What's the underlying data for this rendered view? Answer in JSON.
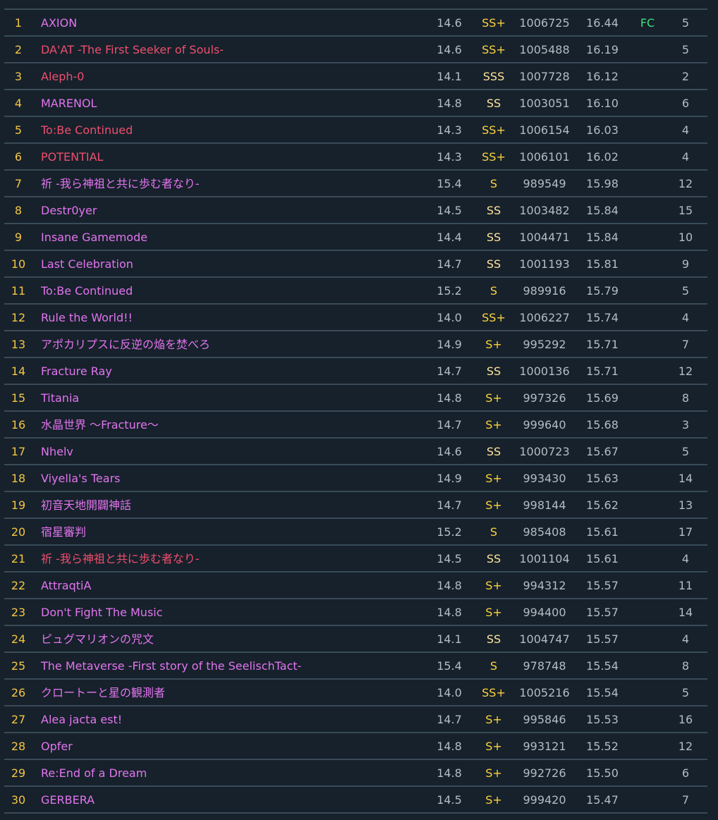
{
  "colors": {
    "background": "#16212b",
    "rank": "#f5c542",
    "title_default": "#e374ef",
    "title_highlight": "#f04e6e",
    "grade": "#ffd23f",
    "value": "#b4bcc4",
    "lamp": "#3fe07a"
  },
  "rows": [
    {
      "rank": "1",
      "title": "AXION",
      "style": "magenta",
      "const": "14.6",
      "grade": "SS+",
      "score": "1006725",
      "rating": "16.44",
      "lamp": "FC",
      "count": "5"
    },
    {
      "rank": "2",
      "title": "DA'AT -The First Seeker of Souls-",
      "style": "red",
      "const": "14.6",
      "grade": "SS+",
      "score": "1005488",
      "rating": "16.19",
      "lamp": "",
      "count": "5"
    },
    {
      "rank": "3",
      "title": "Aleph-0",
      "style": "red",
      "const": "14.1",
      "grade": "SSS",
      "score": "1007728",
      "rating": "16.12",
      "lamp": "",
      "count": "2"
    },
    {
      "rank": "4",
      "title": "MARENOL",
      "style": "magenta",
      "const": "14.8",
      "grade": "SS",
      "score": "1003051",
      "rating": "16.10",
      "lamp": "",
      "count": "6"
    },
    {
      "rank": "5",
      "title": "To:Be Continued",
      "style": "red",
      "const": "14.3",
      "grade": "SS+",
      "score": "1006154",
      "rating": "16.03",
      "lamp": "",
      "count": "4"
    },
    {
      "rank": "6",
      "title": "POTENTIAL",
      "style": "red",
      "const": "14.3",
      "grade": "SS+",
      "score": "1006101",
      "rating": "16.02",
      "lamp": "",
      "count": "4"
    },
    {
      "rank": "7",
      "title": "祈 -我ら神祖と共に歩む者なり-",
      "style": "magenta",
      "const": "15.4",
      "grade": "S",
      "score": "989549",
      "rating": "15.98",
      "lamp": "",
      "count": "12"
    },
    {
      "rank": "8",
      "title": "Destr0yer",
      "style": "magenta",
      "const": "14.5",
      "grade": "SS",
      "score": "1003482",
      "rating": "15.84",
      "lamp": "",
      "count": "15"
    },
    {
      "rank": "9",
      "title": "Insane Gamemode",
      "style": "magenta",
      "const": "14.4",
      "grade": "SS",
      "score": "1004471",
      "rating": "15.84",
      "lamp": "",
      "count": "10"
    },
    {
      "rank": "10",
      "title": "Last Celebration",
      "style": "magenta",
      "const": "14.7",
      "grade": "SS",
      "score": "1001193",
      "rating": "15.81",
      "lamp": "",
      "count": "9"
    },
    {
      "rank": "11",
      "title": "To:Be Continued",
      "style": "magenta",
      "const": "15.2",
      "grade": "S",
      "score": "989916",
      "rating": "15.79",
      "lamp": "",
      "count": "5"
    },
    {
      "rank": "12",
      "title": "Rule the World!!",
      "style": "magenta",
      "const": "14.0",
      "grade": "SS+",
      "score": "1006227",
      "rating": "15.74",
      "lamp": "",
      "count": "4"
    },
    {
      "rank": "13",
      "title": "アポカリプスに反逆の焔を焚べろ",
      "style": "magenta",
      "const": "14.9",
      "grade": "S+",
      "score": "995292",
      "rating": "15.71",
      "lamp": "",
      "count": "7"
    },
    {
      "rank": "14",
      "title": "Fracture Ray",
      "style": "magenta",
      "const": "14.7",
      "grade": "SS",
      "score": "1000136",
      "rating": "15.71",
      "lamp": "",
      "count": "12"
    },
    {
      "rank": "15",
      "title": "Titania",
      "style": "magenta",
      "const": "14.8",
      "grade": "S+",
      "score": "997326",
      "rating": "15.69",
      "lamp": "",
      "count": "8"
    },
    {
      "rank": "16",
      "title": "水晶世界 ～Fracture～",
      "style": "magenta",
      "const": "14.7",
      "grade": "S+",
      "score": "999640",
      "rating": "15.68",
      "lamp": "",
      "count": "3"
    },
    {
      "rank": "17",
      "title": "Nhelv",
      "style": "magenta",
      "const": "14.6",
      "grade": "SS",
      "score": "1000723",
      "rating": "15.67",
      "lamp": "",
      "count": "5"
    },
    {
      "rank": "18",
      "title": "Viyella's Tears",
      "style": "magenta",
      "const": "14.9",
      "grade": "S+",
      "score": "993430",
      "rating": "15.63",
      "lamp": "",
      "count": "14"
    },
    {
      "rank": "19",
      "title": "初音天地開闢神話",
      "style": "magenta",
      "const": "14.7",
      "grade": "S+",
      "score": "998144",
      "rating": "15.62",
      "lamp": "",
      "count": "13"
    },
    {
      "rank": "20",
      "title": "宿星審判",
      "style": "magenta",
      "const": "15.2",
      "grade": "S",
      "score": "985408",
      "rating": "15.61",
      "lamp": "",
      "count": "17"
    },
    {
      "rank": "21",
      "title": "祈 -我ら神祖と共に歩む者なり-",
      "style": "red",
      "const": "14.5",
      "grade": "SS",
      "score": "1001104",
      "rating": "15.61",
      "lamp": "",
      "count": "4"
    },
    {
      "rank": "22",
      "title": "AttraqtiA",
      "style": "magenta",
      "const": "14.8",
      "grade": "S+",
      "score": "994312",
      "rating": "15.57",
      "lamp": "",
      "count": "11"
    },
    {
      "rank": "23",
      "title": "Don't Fight The Music",
      "style": "magenta",
      "const": "14.8",
      "grade": "S+",
      "score": "994400",
      "rating": "15.57",
      "lamp": "",
      "count": "14"
    },
    {
      "rank": "24",
      "title": "ピュグマリオンの咒文",
      "style": "magenta",
      "const": "14.1",
      "grade": "SS",
      "score": "1004747",
      "rating": "15.57",
      "lamp": "",
      "count": "4"
    },
    {
      "rank": "25",
      "title": "The Metaverse -First story of the SeelischTact-",
      "style": "magenta",
      "const": "15.4",
      "grade": "S",
      "score": "978748",
      "rating": "15.54",
      "lamp": "",
      "count": "8"
    },
    {
      "rank": "26",
      "title": "クロートーと星の観測者",
      "style": "magenta",
      "const": "14.0",
      "grade": "SS+",
      "score": "1005216",
      "rating": "15.54",
      "lamp": "",
      "count": "5"
    },
    {
      "rank": "27",
      "title": "Alea jacta est!",
      "style": "magenta",
      "const": "14.7",
      "grade": "S+",
      "score": "995846",
      "rating": "15.53",
      "lamp": "",
      "count": "16"
    },
    {
      "rank": "28",
      "title": "Opfer",
      "style": "magenta",
      "const": "14.8",
      "grade": "S+",
      "score": "993121",
      "rating": "15.52",
      "lamp": "",
      "count": "12"
    },
    {
      "rank": "29",
      "title": "Re:End of a Dream",
      "style": "magenta",
      "const": "14.8",
      "grade": "S+",
      "score": "992726",
      "rating": "15.50",
      "lamp": "",
      "count": "6"
    },
    {
      "rank": "30",
      "title": "GERBERA",
      "style": "magenta",
      "const": "14.5",
      "grade": "S+",
      "score": "999420",
      "rating": "15.47",
      "lamp": "",
      "count": "7"
    }
  ]
}
